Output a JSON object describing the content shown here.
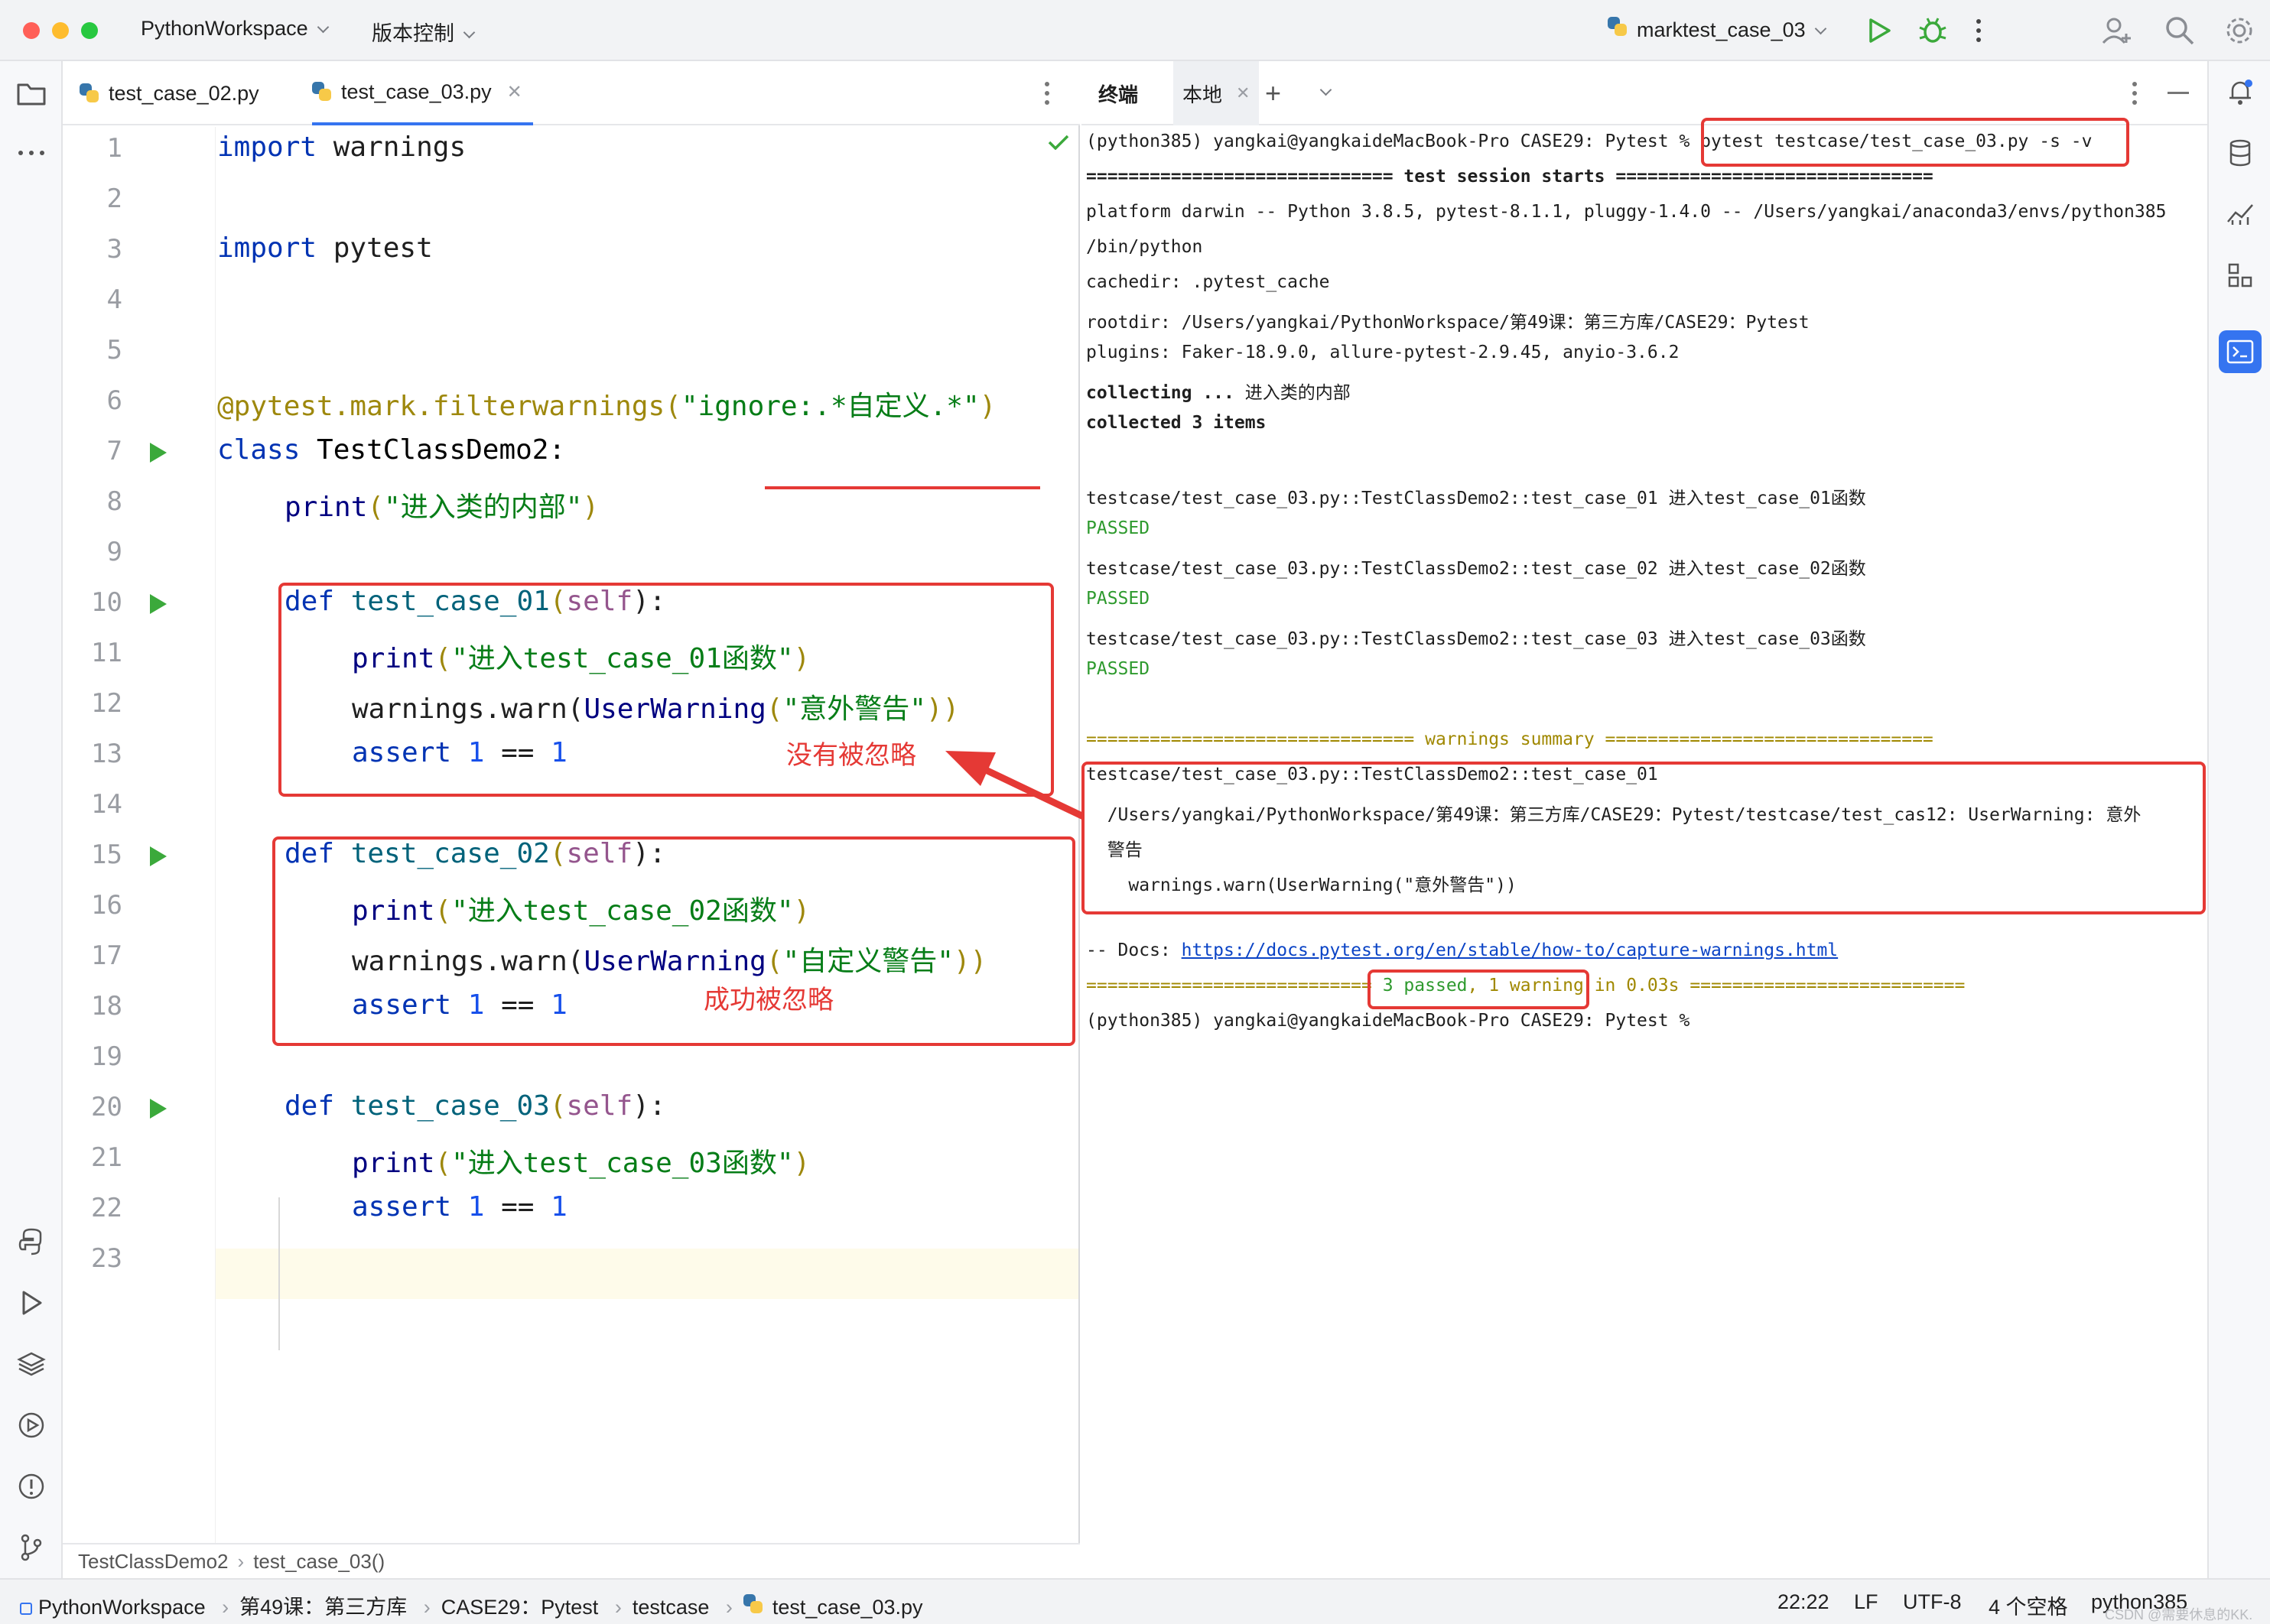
{
  "titlebar": {
    "project": "PythonWorkspace",
    "vcs": "版本控制",
    "run_config": "marktest_case_03"
  },
  "editor": {
    "tabs": [
      {
        "label": "test_case_02.py"
      },
      {
        "label": "test_case_03.py"
      }
    ],
    "line_numbers": [
      "1",
      "2",
      "3",
      "4",
      "5",
      "6",
      "7",
      "8",
      "9",
      "10",
      "11",
      "12",
      "13",
      "14",
      "15",
      "16",
      "17",
      "18",
      "19",
      "20",
      "21",
      "22",
      "23"
    ],
    "code": {
      "l1_kw": "import",
      "l1_rest": " warnings",
      "l3_kw": "import",
      "l3_rest": " pytest",
      "l6_deco": "@pytest.mark.filterwarnings(",
      "l6_str": "\"ignore:.*自定义.*\"",
      "l6_end": ")",
      "l7_kw": "class",
      "l7_rest": " TestClassDemo2:",
      "l8_fn": "print",
      "l8_open": "(",
      "l8_str": "\"进入类的内部\"",
      "l8_close": ")",
      "l10_kw": "def",
      "l10_fn": " test_case_01",
      "l10_open": "(",
      "l10_self": "self",
      "l10_close": "):",
      "l11_fn": "print",
      "l11_open": "(",
      "l11_str": "\"进入test_case_01函数\"",
      "l11_close": ")",
      "l12_a": "warnings.warn(",
      "l12_cls": "UserWarning",
      "l12_open": "(",
      "l12_str": "\"意外警告\"",
      "l12_close": "))",
      "l13_kw": "assert",
      "l13_n1": " 1",
      "l13_op": " == ",
      "l13_n2": "1",
      "l15_kw": "def",
      "l15_fn": " test_case_02",
      "l15_open": "(",
      "l15_self": "self",
      "l15_close": "):",
      "l16_fn": "print",
      "l16_open": "(",
      "l16_str": "\"进入test_case_02函数\"",
      "l16_close": ")",
      "l17_a": "warnings.warn(",
      "l17_cls": "UserWarning",
      "l17_open": "(",
      "l17_str": "\"自定义警告\"",
      "l17_close": "))",
      "l18_kw": "assert",
      "l18_n1": " 1",
      "l18_op": " == ",
      "l18_n2": "1",
      "l20_kw": "def",
      "l20_fn": " test_case_03",
      "l20_open": "(",
      "l20_self": "self",
      "l20_close": "):",
      "l21_fn": "print",
      "l21_open": "(",
      "l21_str": "\"进入test_case_03函数\"",
      "l21_close": ")",
      "l22_kw": "assert",
      "l22_n1": " 1",
      "l22_op": " == ",
      "l22_n2": "1"
    },
    "annotations": {
      "not_ignored": "没有被忽略",
      "ignored": "成功被忽略"
    },
    "breadcrumb": [
      "TestClassDemo2",
      "test_case_03()"
    ]
  },
  "terminal": {
    "tabs": [
      {
        "label": "终端"
      },
      {
        "label": "本地"
      }
    ],
    "lines": {
      "t1_prompt": "(python385) yangkai@yangkaideMacBook-Pro CASE29: Pytest % ",
      "t1_cmd": "pytest testcase/test_case_03.py -s -v",
      "t2": "============================= test session starts ==============================",
      "t3": "platform darwin -- Python 3.8.5, pytest-8.1.1, pluggy-1.4.0 -- /Users/yangkai/anaconda3/envs/python385",
      "t4": "/bin/python",
      "t5": "cachedir: .pytest_cache",
      "t6": "rootdir: /Users/yangkai/PythonWorkspace/第49课：第三方库/CASE29：Pytest",
      "t7": "plugins: Faker-18.9.0, allure-pytest-2.9.45, anyio-3.6.2",
      "t8_a": "collecting ... ",
      "t8_b": "进入类的内部",
      "t9": "collected 3 items",
      "t10": "testcase/test_case_03.py::TestClassDemo2::test_case_01 进入test_case_01函数",
      "t11": "PASSED",
      "t12": "testcase/test_case_03.py::TestClassDemo2::test_case_02 进入test_case_02函数",
      "t13": "PASSED",
      "t14": "testcase/test_case_03.py::TestClassDemo2::test_case_03 进入test_case_03函数",
      "t15": "PASSED",
      "t16": "=============================== warnings summary ===============================",
      "t17": "testcase/test_case_03.py::TestClassDemo2::test_case_01",
      "t18": "  /Users/yangkai/PythonWorkspace/第49课：第三方库/CASE29：Pytest/testcase/test_cas12: UserWarning: 意外",
      "t19": "  警告",
      "t20": "    warnings.warn(UserWarning(\"意外警告\"))",
      "t21_a": "-- Docs: ",
      "t21_link": "https://docs.pytest.org/en/stable/how-to/capture-warnings.html",
      "t22_a": "=========================== ",
      "t22_b": "3 passed",
      "t22_c": ", ",
      "t22_d": "1 warning",
      "t22_e": " in 0.03s",
      "t22_f": " ==========================",
      "t23": "(python385) yangkai@yangkaideMacBook-Pro CASE29: Pytest % "
    }
  },
  "statusbar": {
    "path": [
      "PythonWorkspace",
      "第49课：第三方库",
      "CASE29：Pytest",
      "testcase",
      "test_case_03.py"
    ],
    "position": "22:22",
    "line_sep": "LF",
    "encoding": "UTF-8",
    "indent": "4 个空格",
    "interpreter": "python385",
    "watermark": "CSDN @需要休息的KK."
  },
  "colors": {
    "accent": "#3574f0",
    "annotation_red": "#e53935",
    "run_green": "#3ba93b"
  }
}
